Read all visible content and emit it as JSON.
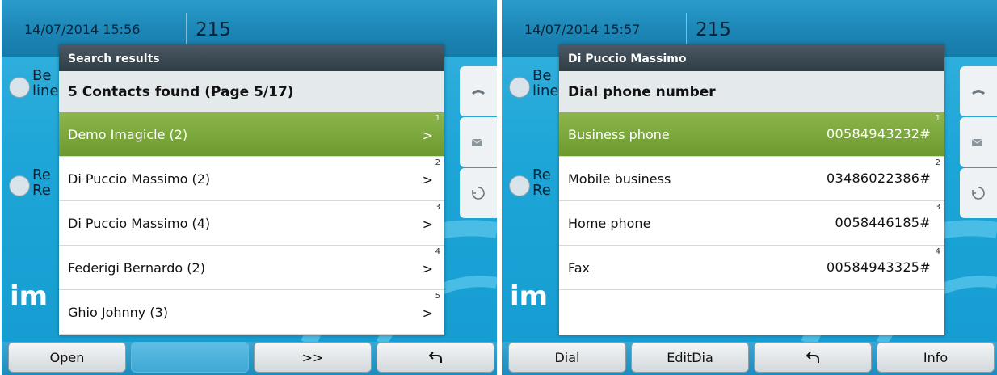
{
  "screens": [
    {
      "datetime": "14/07/2014 15:56",
      "line_number": "215",
      "bg_line1": [
        "Be",
        "line"
      ],
      "bg_line2": [
        "Re",
        "Re"
      ],
      "brand_text": "im",
      "title": "Search results",
      "subtitle": "5 Contacts found (Page 5/17)",
      "rows": [
        {
          "label": "Demo Imagicle (2)",
          "index": "1",
          "selected": true
        },
        {
          "label": "Di Puccio Massimo (2)",
          "index": "2",
          "selected": false
        },
        {
          "label": "Di Puccio Massimo (4)",
          "index": "3",
          "selected": false
        },
        {
          "label": "Federigi Bernardo (2)",
          "index": "4",
          "selected": false
        },
        {
          "label": "Ghio Johnny (3)",
          "index": "5",
          "selected": false
        }
      ],
      "row_chevron": ">",
      "softkeys": [
        "Open",
        "",
        ">>",
        "back-arrow-icon"
      ]
    },
    {
      "datetime": "14/07/2014 15:57",
      "line_number": "215",
      "bg_line1": [
        "Be",
        "line"
      ],
      "bg_line2": [
        "Re",
        "Re"
      ],
      "brand_text": "im",
      "title": "Di Puccio Massimo",
      "subtitle": "Dial phone number",
      "rows": [
        {
          "label": "Business phone",
          "value": "00584943232#",
          "index": "1",
          "selected": true
        },
        {
          "label": "Mobile business",
          "value": "03486022386#",
          "index": "2",
          "selected": false
        },
        {
          "label": "Home phone",
          "value": "0058446185#",
          "index": "3",
          "selected": false
        },
        {
          "label": "Fax",
          "value": "00584943325#",
          "index": "4",
          "selected": false
        }
      ],
      "softkeys": [
        "Dial",
        "EditDia",
        "back-arrow-icon",
        "Info"
      ]
    }
  ],
  "side_icons": [
    "handset-icon",
    "envelope-icon",
    "history-icon"
  ],
  "colors": {
    "selection": "#7aa63a",
    "title_bar": "#3a4851",
    "screen_bg": "#1ea6d8"
  }
}
